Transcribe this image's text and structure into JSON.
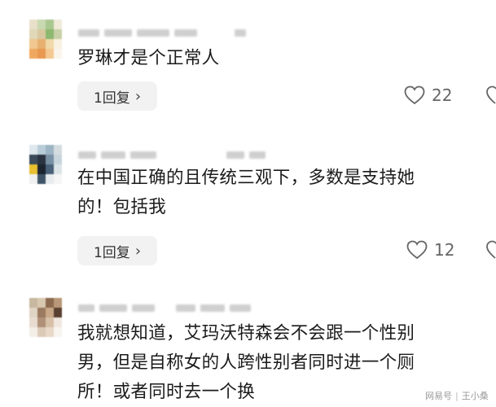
{
  "comments": [
    {
      "text_lines": [
        "罗琳才是个正常人"
      ],
      "reply_label": "1回复",
      "reply_chevron": "›",
      "likes": "22",
      "avatar_colors": [
        "#e8e0c8",
        "#c8d8b0",
        "#a8c890",
        "#f0ead8",
        "#e0d8b8",
        "#d8c8a0",
        "#8cb870",
        "#c8d0a8",
        "#f0c890",
        "#e8b070",
        "#f0d8a8",
        "#f8f0e0",
        "#f0a860",
        "#e89850",
        "#f4c890",
        "#fbf4ea"
      ]
    },
    {
      "text_lines": [
        "在中国正确的且传统三观下，多数是支持她",
        "的！包括我"
      ],
      "reply_label": "1回复",
      "reply_chevron": "›",
      "likes": "12",
      "avatar_colors": [
        "#dfe8ec",
        "#b8ccd8",
        "#9cb4c4",
        "#d4dce0",
        "#3a4a5a",
        "#2a3440",
        "#7890a4",
        "#c8d4dc",
        "#e8c030",
        "#1c2430",
        "#486078",
        "#dce4e8",
        "#f0f0f0",
        "#405468",
        "#e8ecee",
        "#f6f6f6"
      ]
    },
    {
      "text_lines": [
        "我就想知道，艾玛沃特森会不会跟一个性别",
        "男，但是自称女的人跨性别者同时进一个厕",
        "所！或者同时去一个换"
      ],
      "avatar_colors": [
        "#c8b8a0",
        "#d8c8b0",
        "#8c6a50",
        "#b89878",
        "#e0d4c4",
        "#9a7a60",
        "#c8a888",
        "#5a4030",
        "#e8dcd0",
        "#b09078",
        "#d8c0a8",
        "#f0e8e0",
        "#f4eee8",
        "#dccab8",
        "#e8d8c8",
        "#f8f4f0"
      ]
    }
  ],
  "watermark": {
    "left": "网易号",
    "right": "王小桑"
  }
}
